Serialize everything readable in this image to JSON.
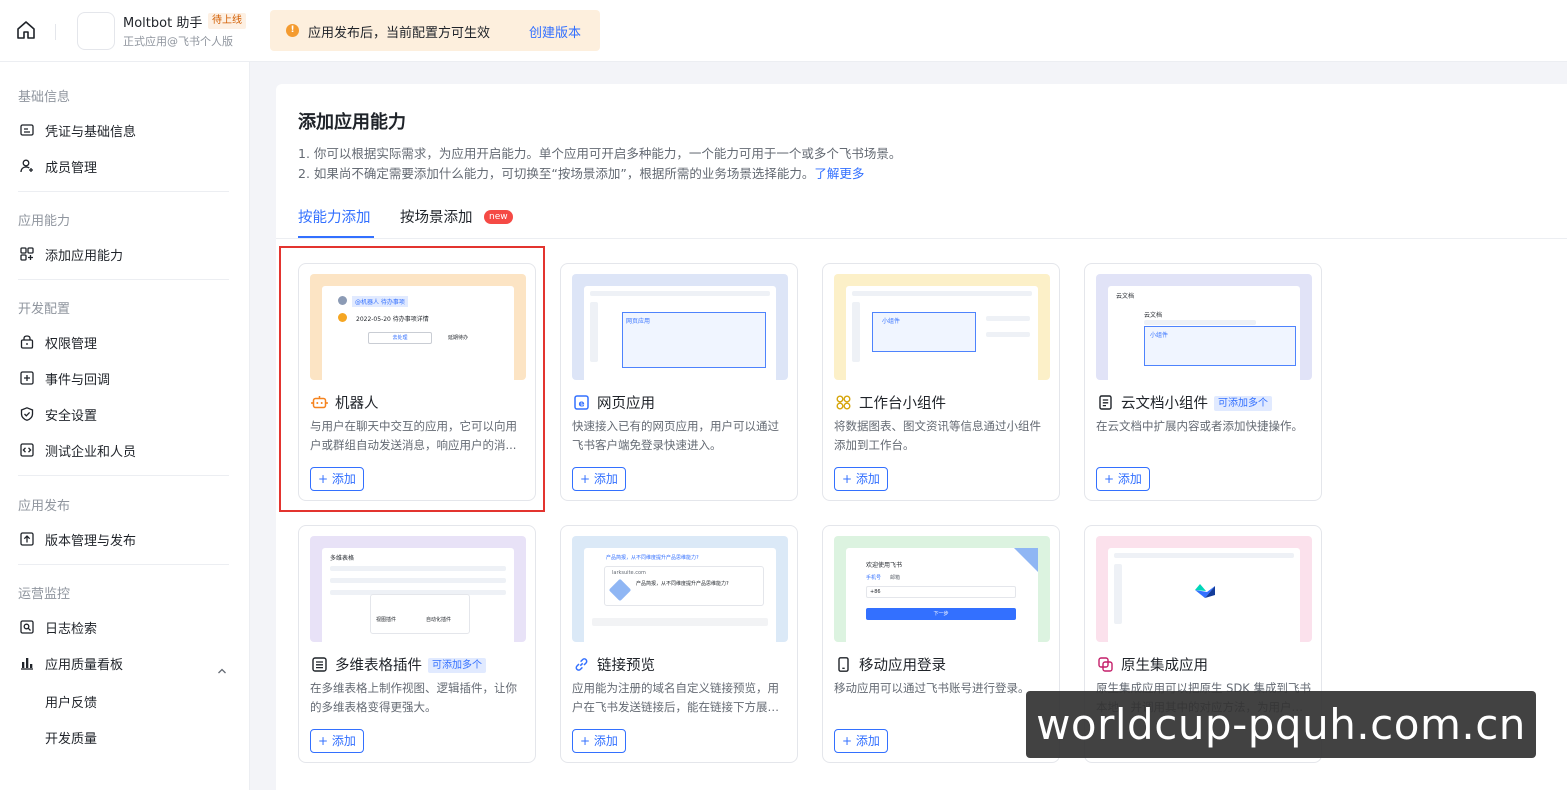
{
  "topbar": {
    "app_name": "Moltbot 助手",
    "app_status": "待上线",
    "app_sub": "正式应用@飞书个人版",
    "notice_text": "应用发布后，当前配置方可生效",
    "notice_link": "创建版本"
  },
  "sidebar": {
    "sections": [
      {
        "title": "基础信息",
        "items": [
          "凭证与基础信息",
          "成员管理"
        ]
      },
      {
        "title": "应用能力",
        "items": [
          "添加应用能力"
        ]
      },
      {
        "title": "开发配置",
        "items": [
          "权限管理",
          "事件与回调",
          "安全设置",
          "测试企业和人员"
        ]
      },
      {
        "title": "应用发布",
        "items": [
          "版本管理与发布"
        ]
      },
      {
        "title": "运营监控",
        "items": [
          "日志检索",
          "应用质量看板"
        ],
        "subitems": [
          "用户反馈",
          "开发质量"
        ]
      }
    ]
  },
  "main": {
    "title": "添加应用能力",
    "desc1": "1. 你可以根据实际需求，为应用开启能力。单个应用可开启多种能力，一个能力可用于一个或多个飞书场景。",
    "desc2": "2. 如果尚不确定需要添加什么能力，可切换至“按场景添加”，根据所需的业务场景选择能力。",
    "desc2_link": "了解更多",
    "tabs": [
      "按能力添加",
      "按场景添加"
    ],
    "new_badge": "new",
    "add_label": "+ 添加",
    "multi_badge": "可添加多个",
    "cards": [
      {
        "title": "机器人",
        "desc": "与用户在聊天中交互的应用，它可以向用户或群组自动发送消息，响应用户的消..."
      },
      {
        "title": "网页应用",
        "desc": "快速接入已有的网页应用，用户可以通过飞书客户端免登录快速进入。"
      },
      {
        "title": "工作台小组件",
        "desc": "将数据图表、图文资讯等信息通过小组件添加到工作台。"
      },
      {
        "title": "云文档小组件",
        "desc": "在云文档中扩展内容或者添加快捷操作。"
      },
      {
        "title": "多维表格插件",
        "desc": "在多维表格上制作视图、逻辑插件，让你的多维表格变得更强大。"
      },
      {
        "title": "链接预览",
        "desc": "应用能为注册的域名自定义链接预览，用户在飞书发送链接后，能在链接下方展示..."
      },
      {
        "title": "移动应用登录",
        "desc": "移动应用可以通过飞书账号进行登录。"
      },
      {
        "title": "原生集成应用",
        "desc": "原生集成应用可以把原生 SDK 集成到飞书本地，并调用其中的对应方法，为用户提..."
      }
    ],
    "previews": {
      "bot_tag": "@机器人 待办事项",
      "bot_line": "2022-05-20 待办事项详情",
      "bot_btn1": "去处理",
      "bot_btn2": "延期待办",
      "web_label": "网页应用",
      "widget_label": "小组件",
      "doc_head": "云文档",
      "doc_title": "云文档",
      "doc_label": "小组件",
      "base_head": "多维表格",
      "base_a": "视图插件",
      "base_b": "自动化插件",
      "link_q": "产品简报，从不同维度提升产品思维能力?",
      "link_host": "larksuite.com",
      "link_a": "产品简报，从不同维度提升产品思维能力?",
      "login_welcome": "欢迎使用飞书",
      "login_tab1": "手机号",
      "login_tab2": "邮箱",
      "login_code": "+86",
      "login_btn": "下一步"
    }
  },
  "watermark": "worldcup-pquh.com.cn"
}
